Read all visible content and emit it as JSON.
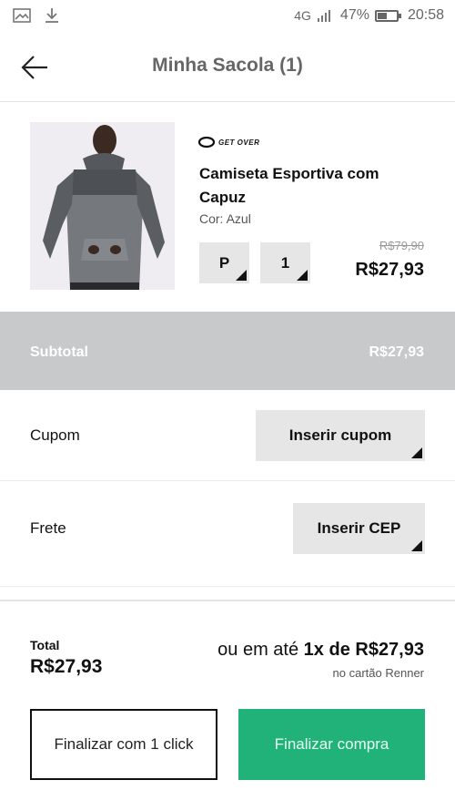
{
  "status_bar": {
    "network": "4G",
    "battery": "47%",
    "battery_level": 0.47,
    "time": "20:58",
    "icons": [
      "image-icon",
      "download-icon",
      "signal-icon",
      "battery-icon"
    ]
  },
  "header": {
    "title": "Minha Sacola (1)",
    "back_icon": "arrow-left-icon"
  },
  "product": {
    "brand": "GET OVER",
    "name": "Camiseta Esportiva com Capuz",
    "color_label": "Cor: Azul",
    "size": "P",
    "quantity": "1",
    "old_price": "R$79,90",
    "price": "R$27,93"
  },
  "subtotal": {
    "label": "Subtotal",
    "value": "R$27,93"
  },
  "coupon": {
    "label": "Cupom",
    "button": "Inserir cupom"
  },
  "shipping": {
    "label": "Frete",
    "button": "Inserir CEP"
  },
  "total": {
    "label": "Total",
    "value": "R$27,93",
    "installment_prefix": "ou em até ",
    "installment_value": "1x de R$27,93",
    "card_note": "no cartão Renner"
  },
  "actions": {
    "one_click": "Finalizar com 1 click",
    "checkout": "Finalizar compra"
  },
  "colors": {
    "accent_green": "#21b27a",
    "subtotal_gray": "#c8c9ca",
    "button_gray": "#e6e6e6"
  }
}
